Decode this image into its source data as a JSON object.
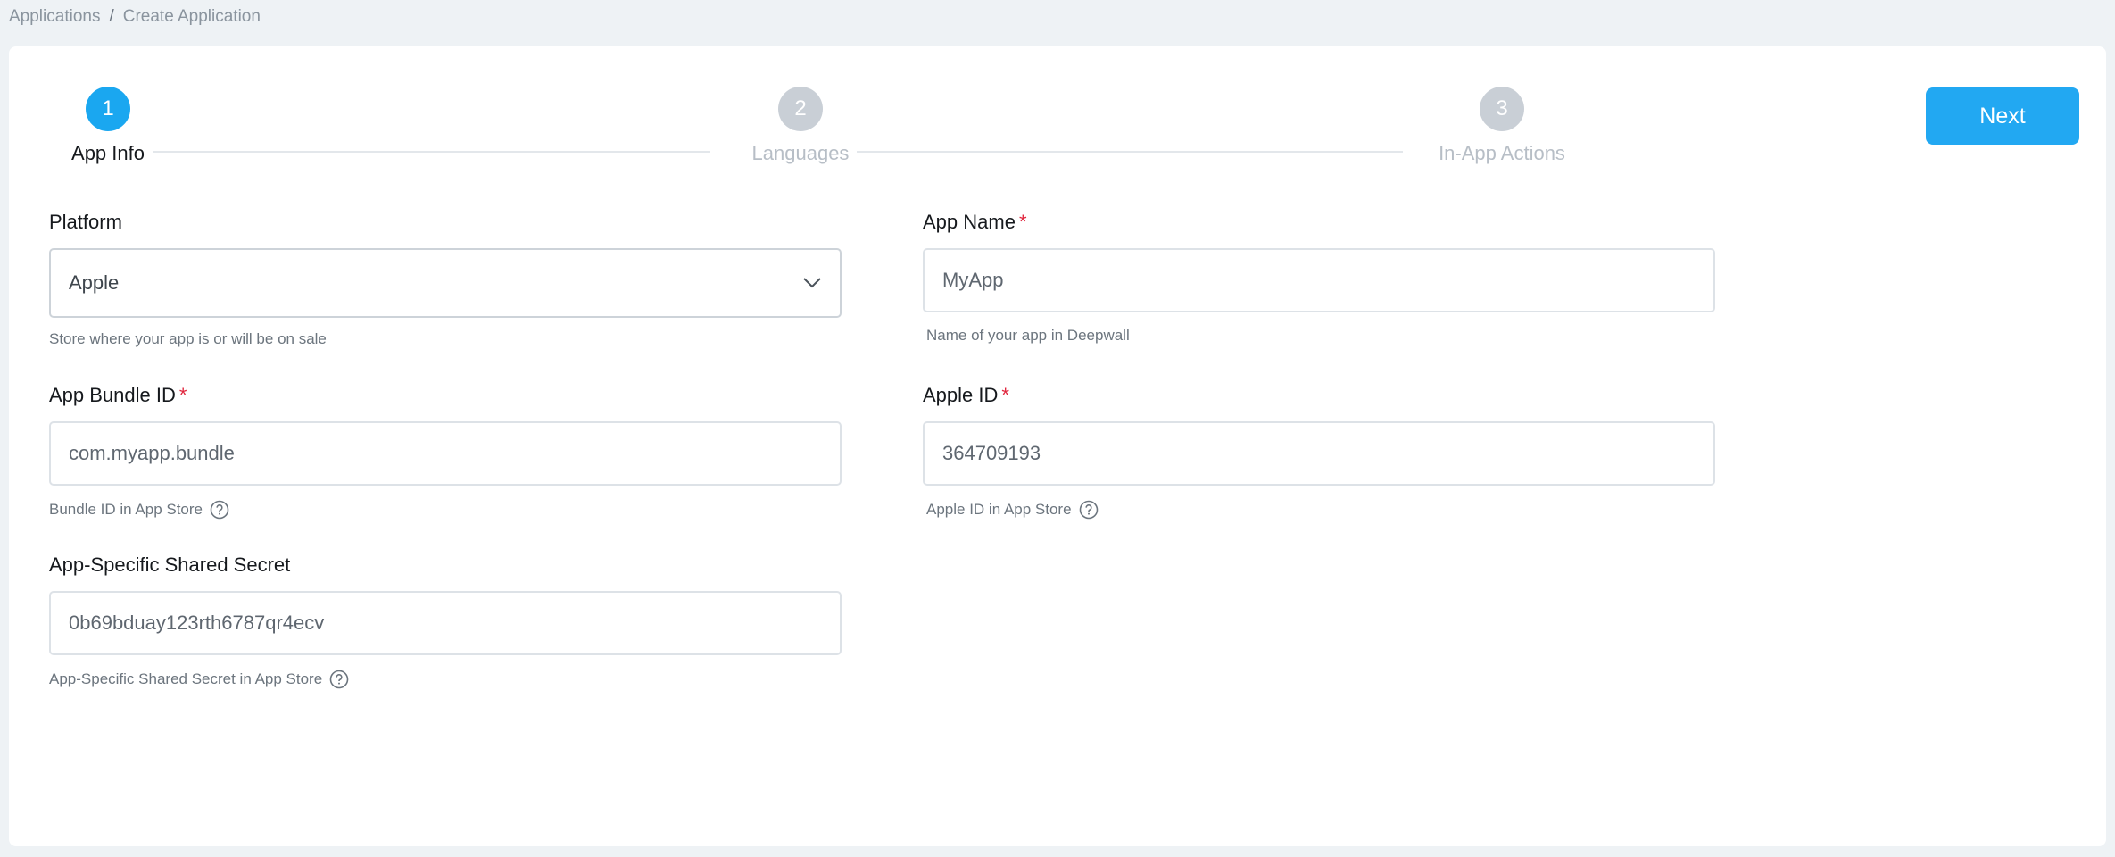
{
  "breadcrumb": {
    "items": [
      "Applications",
      "Create Application"
    ],
    "separator": "/"
  },
  "stepper": {
    "steps": [
      {
        "number": "1",
        "label": "App Info",
        "state": "active"
      },
      {
        "number": "2",
        "label": "Languages",
        "state": "inactive"
      },
      {
        "number": "3",
        "label": "In-App Actions",
        "state": "inactive"
      }
    ],
    "active_color": "#1aa7f0",
    "inactive_color": "#c9cfd6"
  },
  "toolbar": {
    "next_label": "Next",
    "next_color": "#22a8f2"
  },
  "form": {
    "platform": {
      "label": "Platform",
      "value": "Apple",
      "help": "Store where your app is or will be on sale"
    },
    "app_name": {
      "label": "App Name",
      "required": "*",
      "value": "MyApp",
      "help": "Name of your app in Deepwall"
    },
    "bundle_id": {
      "label": "App Bundle ID",
      "required": "*",
      "value": "com.myapp.bundle",
      "help": "Bundle ID in App Store"
    },
    "apple_id": {
      "label": "Apple ID",
      "required": "*",
      "value": "364709193",
      "help": "Apple ID in App Store"
    },
    "shared_secret": {
      "label": "App-Specific Shared Secret",
      "value": "0b69bduay123rth6787qr4ecv",
      "help": "App-Specific Shared Secret in App Store"
    }
  },
  "icons": {
    "help": "question-circle-icon",
    "dropdown": "chevron-down-icon"
  },
  "colors": {
    "required_mark": "#e0243c",
    "page_background": "#eef2f5"
  }
}
